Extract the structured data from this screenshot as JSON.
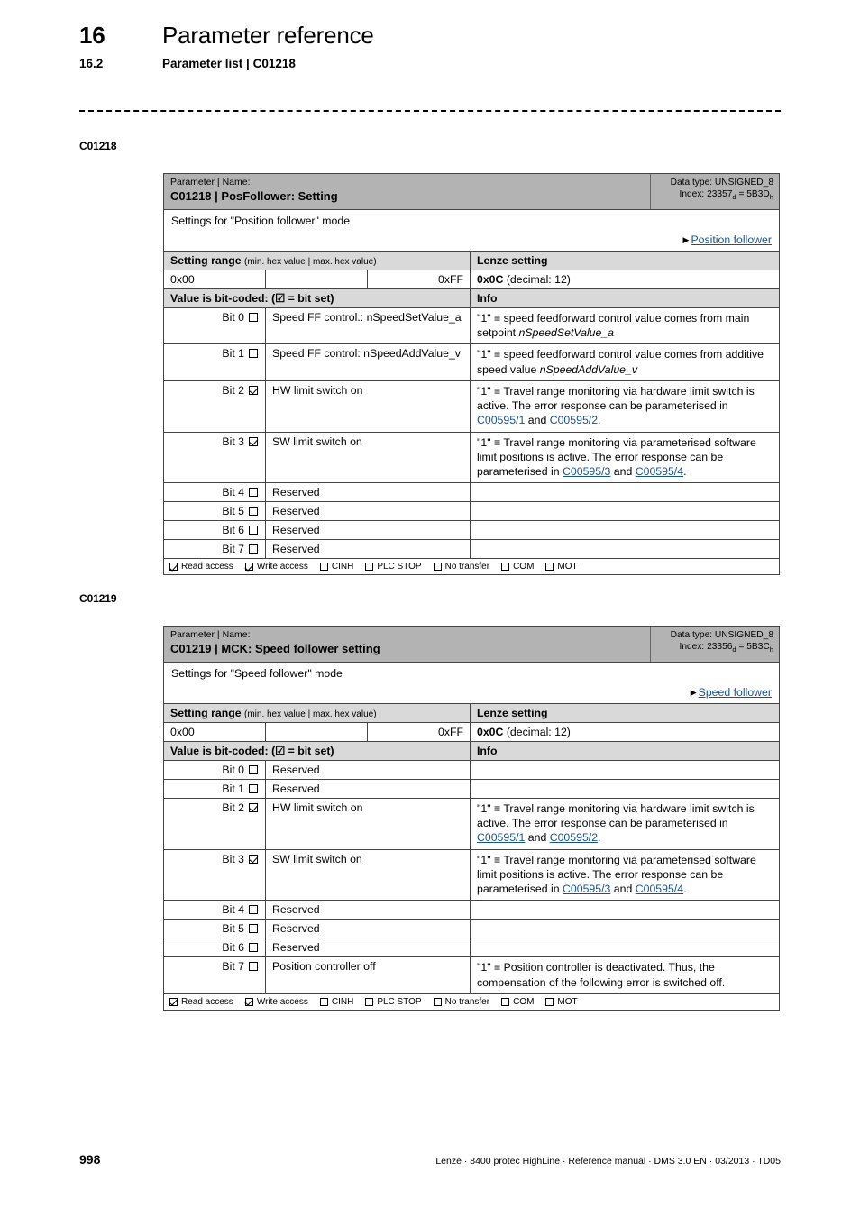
{
  "header": {
    "chapter_number": "16",
    "chapter_title": "Parameter reference",
    "section_number": "16.2",
    "section_title": "Parameter list | C01218"
  },
  "margin_labels": {
    "first": "C01218",
    "second": "C01219"
  },
  "colors": {
    "header_gray": "#b3b3b3",
    "subheader_gray": "#d9d9d9",
    "link_blue": "#1a5490"
  },
  "tables": [
    {
      "param_name_caption": "Parameter | Name:",
      "param_title": "C01218 | PosFollower: Setting",
      "data_type_label": "Data type: UNSIGNED_8",
      "index_prefix": "Index: ",
      "index_dec": "23357",
      "index_dec_sub": "d",
      "index_eq": " = ",
      "index_hex": "5B3D",
      "index_hex_sub": "h",
      "description": "Settings for \"Position follower\" mode",
      "xref_arrow": "▶",
      "xref_label": "Position follower",
      "setting_range_header": "Setting range",
      "setting_range_note": "(min. hex value | max. hex value)",
      "lenze_setting_header": "Lenze setting",
      "range_min": "0x00",
      "range_mid": "",
      "range_max": "0xFF",
      "lenze_value": "0x0C",
      "lenze_value_decimal": "(decimal: 12)",
      "bitcoded_header": "Value is bit-coded:",
      "bitcoded_note": "(☑ = bit set)",
      "info_header": "Info",
      "bits": [
        {
          "bit": "Bit 0",
          "set": false,
          "label": "Speed FF control.: nSpeedSetValue_a",
          "label_italic": "",
          "info_parts": [
            {
              "type": "text",
              "text": "\"1\" ≡ speed feedforward control value comes from main setpoint "
            },
            {
              "type": "italic",
              "text": "nSpeedSetValue_a"
            }
          ]
        },
        {
          "bit": "Bit 1",
          "set": false,
          "label": "Speed FF control: nSpeedAddValue_v",
          "label_italic": "",
          "info_parts": [
            {
              "type": "text",
              "text": "\"1\" ≡ speed feedforward control value comes from additive speed value "
            },
            {
              "type": "italic",
              "text": "nSpeedAddValue_v"
            }
          ]
        },
        {
          "bit": "Bit 2",
          "set": true,
          "label": "HW limit switch on",
          "info_parts": [
            {
              "type": "text",
              "text": "\"1\" ≡ Travel range monitoring via hardware limit switch is active. The error response can be parameterised in "
            },
            {
              "type": "link",
              "text": "C00595/1"
            },
            {
              "type": "text",
              "text": " and "
            },
            {
              "type": "link",
              "text": "C00595/2"
            },
            {
              "type": "text",
              "text": "."
            }
          ]
        },
        {
          "bit": "Bit 3",
          "set": true,
          "label": "SW limit switch on",
          "info_parts": [
            {
              "type": "text",
              "text": "\"1\" ≡ Travel range monitoring via parameterised software limit positions is active. The error response can be parameterised in "
            },
            {
              "type": "link",
              "text": "C00595/3"
            },
            {
              "type": "text",
              "text": " and "
            },
            {
              "type": "link",
              "text": "C00595/4"
            },
            {
              "type": "text",
              "text": "."
            }
          ]
        },
        {
          "bit": "Bit 4",
          "set": false,
          "label": "Reserved",
          "info_parts": []
        },
        {
          "bit": "Bit 5",
          "set": false,
          "label": "Reserved",
          "info_parts": []
        },
        {
          "bit": "Bit 6",
          "set": false,
          "label": "Reserved",
          "info_parts": []
        },
        {
          "bit": "Bit 7",
          "set": false,
          "label": "Reserved",
          "info_parts": []
        }
      ],
      "access": [
        {
          "label": "Read access",
          "set": true
        },
        {
          "label": "Write access",
          "set": true
        },
        {
          "label": "CINH",
          "set": false
        },
        {
          "label": "PLC STOP",
          "set": false
        },
        {
          "label": "No transfer",
          "set": false
        },
        {
          "label": "COM",
          "set": false
        },
        {
          "label": "MOT",
          "set": false
        }
      ]
    },
    {
      "param_name_caption": "Parameter | Name:",
      "param_title": "C01219 | MCK: Speed follower setting",
      "data_type_label": "Data type: UNSIGNED_8",
      "index_prefix": "Index: ",
      "index_dec": "23356",
      "index_dec_sub": "d",
      "index_eq": " = ",
      "index_hex": "5B3C",
      "index_hex_sub": "h",
      "description": "Settings for \"Speed follower\" mode",
      "xref_arrow": "▶",
      "xref_label": "Speed follower",
      "setting_range_header": "Setting range",
      "setting_range_note": "(min. hex value | max. hex value)",
      "lenze_setting_header": "Lenze setting",
      "range_min": "0x00",
      "range_mid": "",
      "range_max": "0xFF",
      "lenze_value": "0x0C",
      "lenze_value_decimal": "(decimal: 12)",
      "bitcoded_header": "Value is bit-coded:",
      "bitcoded_note": "(☑ = bit set)",
      "info_header": "Info",
      "bits": [
        {
          "bit": "Bit 0",
          "set": false,
          "label": "Reserved",
          "info_parts": []
        },
        {
          "bit": "Bit 1",
          "set": false,
          "label": "Reserved",
          "info_parts": []
        },
        {
          "bit": "Bit 2",
          "set": true,
          "label": "HW limit switch on",
          "info_parts": [
            {
              "type": "text",
              "text": "\"1\" ≡ Travel range monitoring via hardware limit switch is active. The error response can be parameterised in "
            },
            {
              "type": "link",
              "text": "C00595/1"
            },
            {
              "type": "text",
              "text": " and "
            },
            {
              "type": "link",
              "text": "C00595/2"
            },
            {
              "type": "text",
              "text": "."
            }
          ]
        },
        {
          "bit": "Bit 3",
          "set": true,
          "label": "SW limit switch on",
          "info_parts": [
            {
              "type": "text",
              "text": "\"1\" ≡ Travel range monitoring via parameterised software limit positions is active. The error response can be parameterised in "
            },
            {
              "type": "link",
              "text": "C00595/3"
            },
            {
              "type": "text",
              "text": " and "
            },
            {
              "type": "link",
              "text": "C00595/4"
            },
            {
              "type": "text",
              "text": "."
            }
          ]
        },
        {
          "bit": "Bit 4",
          "set": false,
          "label": "Reserved",
          "info_parts": []
        },
        {
          "bit": "Bit 5",
          "set": false,
          "label": "Reserved",
          "info_parts": []
        },
        {
          "bit": "Bit 6",
          "set": false,
          "label": "Reserved",
          "info_parts": []
        },
        {
          "bit": "Bit 7",
          "set": false,
          "label": "Position controller off",
          "info_parts": [
            {
              "type": "text",
              "text": "\"1\" ≡ Position controller is deactivated. Thus, the compensation of the following error is switched off."
            }
          ]
        }
      ],
      "access": [
        {
          "label": "Read access",
          "set": true
        },
        {
          "label": "Write access",
          "set": true
        },
        {
          "label": "CINH",
          "set": false
        },
        {
          "label": "PLC STOP",
          "set": false
        },
        {
          "label": "No transfer",
          "set": false
        },
        {
          "label": "COM",
          "set": false
        },
        {
          "label": "MOT",
          "set": false
        }
      ]
    }
  ],
  "footer": {
    "page_number": "998",
    "text": "Lenze · 8400 protec HighLine · Reference manual · DMS 3.0 EN · 03/2013 · TD05"
  }
}
